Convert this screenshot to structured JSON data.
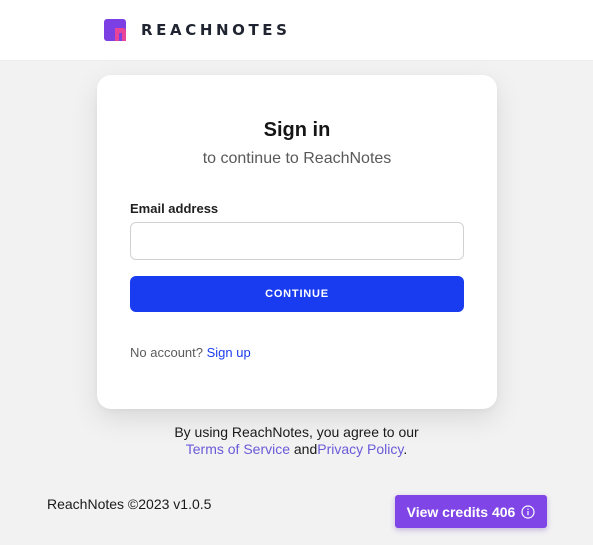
{
  "header": {
    "logo_text": "REACHNOTES",
    "logo_colors": {
      "primary": "#7b3fe4",
      "accent": "#e8459a"
    }
  },
  "signin_card": {
    "title": "Sign in",
    "subtitle": "to continue to ReachNotes",
    "email_label": "Email address",
    "email_value": "",
    "email_placeholder": "",
    "continue_label": "CONTINUE",
    "no_account_text": "No account?",
    "signup_link": "Sign up"
  },
  "legal": {
    "agree_text": "By using ReachNotes, you agree to our",
    "terms_link": "Terms of Service",
    "and_text": "and",
    "privacy_link": "Privacy Policy",
    "period": "."
  },
  "footer": {
    "copyright": "ReachNotes ©2023 v1.0.5",
    "credits_button_label": "View credits 406",
    "credits_icon": "info-icon"
  },
  "colors": {
    "accent_blue": "#1a3cf0",
    "credits_purple": "#8045e6",
    "link_purple": "#6a5ad8"
  }
}
